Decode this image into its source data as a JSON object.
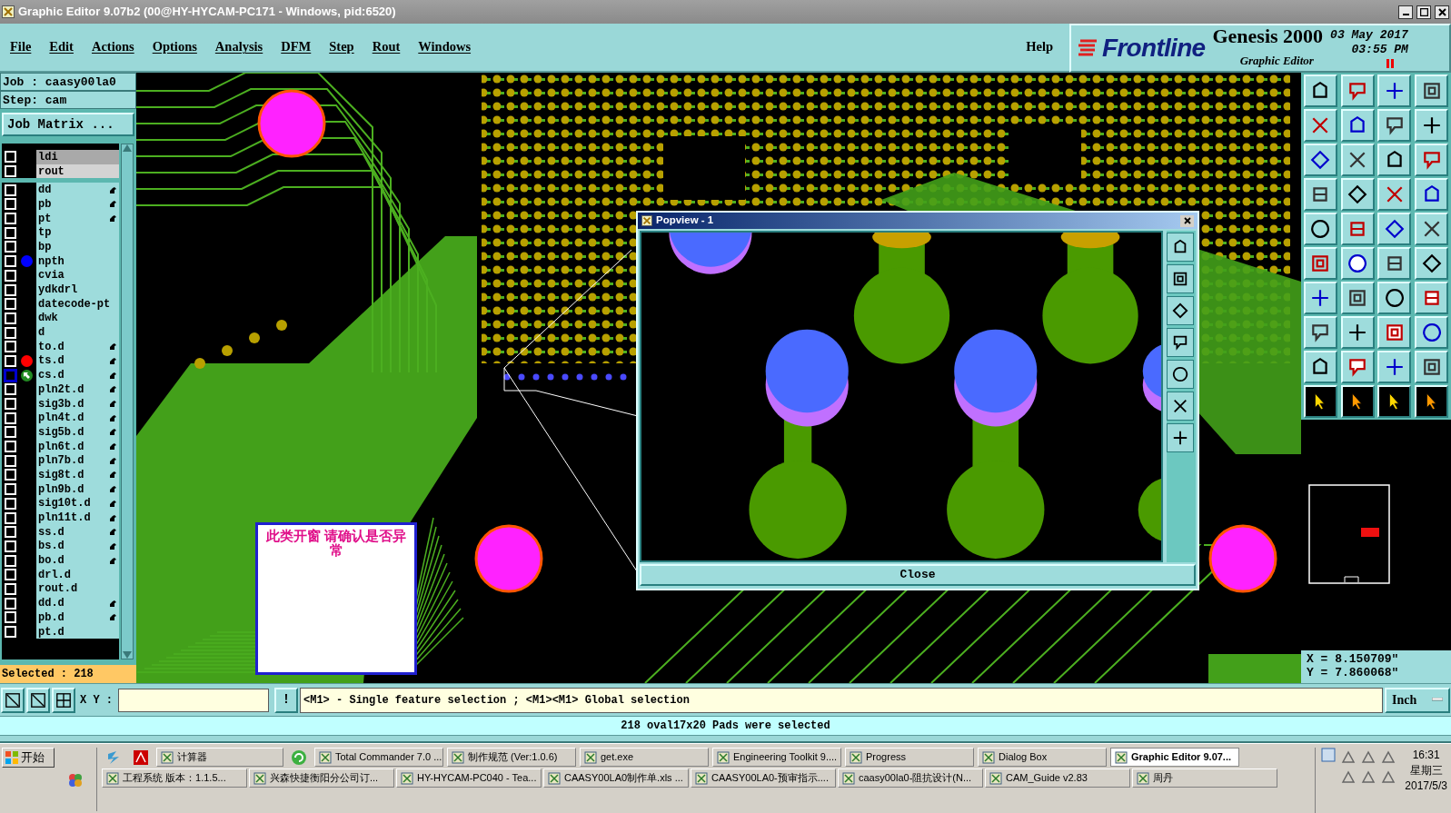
{
  "window": {
    "title": "Graphic Editor 9.07b2 (00@HY-HYCAM-PC171 - Windows, pid:6520)"
  },
  "menu": [
    "File",
    "Edit",
    "Actions",
    "Options",
    "Analysis",
    "DFM",
    "Step",
    "Rout",
    "Windows"
  ],
  "help": "Help",
  "branding": {
    "logo": "Frontline",
    "product": "Genesis 2000",
    "subtitle": "Graphic Editor",
    "date": "03 May 2017",
    "time": "03:55 PM"
  },
  "job_panel": {
    "job": "Job : caasy00la0",
    "step": "Step: cam",
    "matrix_button": "Job Matrix ...",
    "selected": "Selected : 218",
    "layers": [
      {
        "name": "ldi",
        "kind": "board",
        "affected": false,
        "selected": false
      },
      {
        "name": "rout",
        "kind": "board",
        "affected": false,
        "selected": false
      },
      {
        "name": "dd",
        "kind": "misc",
        "affected": true,
        "selected": false
      },
      {
        "name": "pb",
        "kind": "misc",
        "affected": true,
        "selected": false
      },
      {
        "name": "pt",
        "kind": "misc",
        "affected": true,
        "selected": false
      },
      {
        "name": "tp",
        "kind": "misc",
        "affected": false,
        "selected": false
      },
      {
        "name": "bp",
        "kind": "misc",
        "affected": false,
        "selected": false
      },
      {
        "name": "npth",
        "kind": "misc",
        "affected": false,
        "selected": false,
        "color": "#0000ff"
      },
      {
        "name": "cvia",
        "kind": "misc",
        "affected": false,
        "selected": false
      },
      {
        "name": "ydkdrl",
        "kind": "misc",
        "affected": false,
        "selected": false
      },
      {
        "name": "datecode-pt",
        "kind": "misc",
        "affected": false,
        "selected": false
      },
      {
        "name": "dwk",
        "kind": "misc",
        "affected": false,
        "selected": false
      },
      {
        "name": "d",
        "kind": "misc",
        "affected": false,
        "selected": false
      },
      {
        "name": "to.d",
        "kind": "misc",
        "affected": true,
        "selected": false
      },
      {
        "name": "ts.d",
        "kind": "misc",
        "affected": true,
        "selected": false,
        "color": "#ff0000"
      },
      {
        "name": "cs.d",
        "kind": "misc",
        "affected": true,
        "selected": true,
        "color": "#228b22"
      },
      {
        "name": "pln2t.d",
        "kind": "misc",
        "affected": true,
        "selected": false
      },
      {
        "name": "sig3b.d",
        "kind": "misc",
        "affected": true,
        "selected": false
      },
      {
        "name": "pln4t.d",
        "kind": "misc",
        "affected": true,
        "selected": false
      },
      {
        "name": "sig5b.d",
        "kind": "misc",
        "affected": true,
        "selected": false
      },
      {
        "name": "pln6t.d",
        "kind": "misc",
        "affected": true,
        "selected": false
      },
      {
        "name": "pln7b.d",
        "kind": "misc",
        "affected": true,
        "selected": false
      },
      {
        "name": "sig8t.d",
        "kind": "misc",
        "affected": true,
        "selected": false
      },
      {
        "name": "pln9b.d",
        "kind": "misc",
        "affected": true,
        "selected": false
      },
      {
        "name": "sig10t.d",
        "kind": "misc",
        "affected": true,
        "selected": false
      },
      {
        "name": "pln11t.d",
        "kind": "misc",
        "affected": true,
        "selected": false
      },
      {
        "name": "ss.d",
        "kind": "misc",
        "affected": true,
        "selected": false
      },
      {
        "name": "bs.d",
        "kind": "misc",
        "affected": true,
        "selected": false
      },
      {
        "name": "bo.d",
        "kind": "misc",
        "affected": true,
        "selected": false
      },
      {
        "name": "drl.d",
        "kind": "misc",
        "affected": false,
        "selected": false
      },
      {
        "name": "rout.d",
        "kind": "misc",
        "affected": false,
        "selected": false
      },
      {
        "name": "dd.d",
        "kind": "misc",
        "affected": true,
        "selected": false
      },
      {
        "name": "pb.d",
        "kind": "misc",
        "affected": true,
        "selected": false
      },
      {
        "name": "pt.d",
        "kind": "misc",
        "affected": false,
        "selected": false
      }
    ]
  },
  "note": {
    "text": "此类开窗  请确认是否异常"
  },
  "popview": {
    "title": "Popview - 1",
    "close_button": "Close"
  },
  "coordinates": {
    "x": "X = 8.150709\"",
    "y": "Y = 7.860068\""
  },
  "command_bar": {
    "label": "X Y :",
    "action": "!",
    "hint": "<M1> - Single feature selection ; <M1><M1> Global selection",
    "units": "Inch"
  },
  "status": "218 oval17x20 Pads were selected",
  "taskbar": {
    "start": "开始",
    "row1": [
      {
        "label": "计算器",
        "selected": false
      },
      {
        "label": "Total Commander 7.0 ...",
        "selected": false
      },
      {
        "label": "制作规范 (Ver:1.0.6)",
        "selected": false
      },
      {
        "label": "get.exe",
        "selected": false
      },
      {
        "label": "Engineering Toolkit 9....",
        "selected": false
      },
      {
        "label": "Progress",
        "selected": false
      },
      {
        "label": "Dialog Box",
        "selected": false
      },
      {
        "label": "Graphic Editor 9.07...",
        "selected": true
      }
    ],
    "row2": [
      {
        "label": "工程系统  版本：1.1.5...",
        "selected": false
      },
      {
        "label": "兴森快捷衡阳分公司订...",
        "selected": false
      },
      {
        "label": "HY-HYCAM-PC040 - Tea...",
        "selected": false
      },
      {
        "label": "CAASY00LA0制作单.xls ...",
        "selected": false
      },
      {
        "label": "CAASY00LA0-预审指示....",
        "selected": false
      },
      {
        "label": "caasy00la0-阻抗设计(N...",
        "selected": false
      },
      {
        "label": "CAM_Guide v2.83",
        "selected": false
      },
      {
        "label": "周丹",
        "selected": false
      }
    ],
    "clock": {
      "time": "16:31",
      "day": "星期三",
      "date": "2017/5/3"
    }
  }
}
